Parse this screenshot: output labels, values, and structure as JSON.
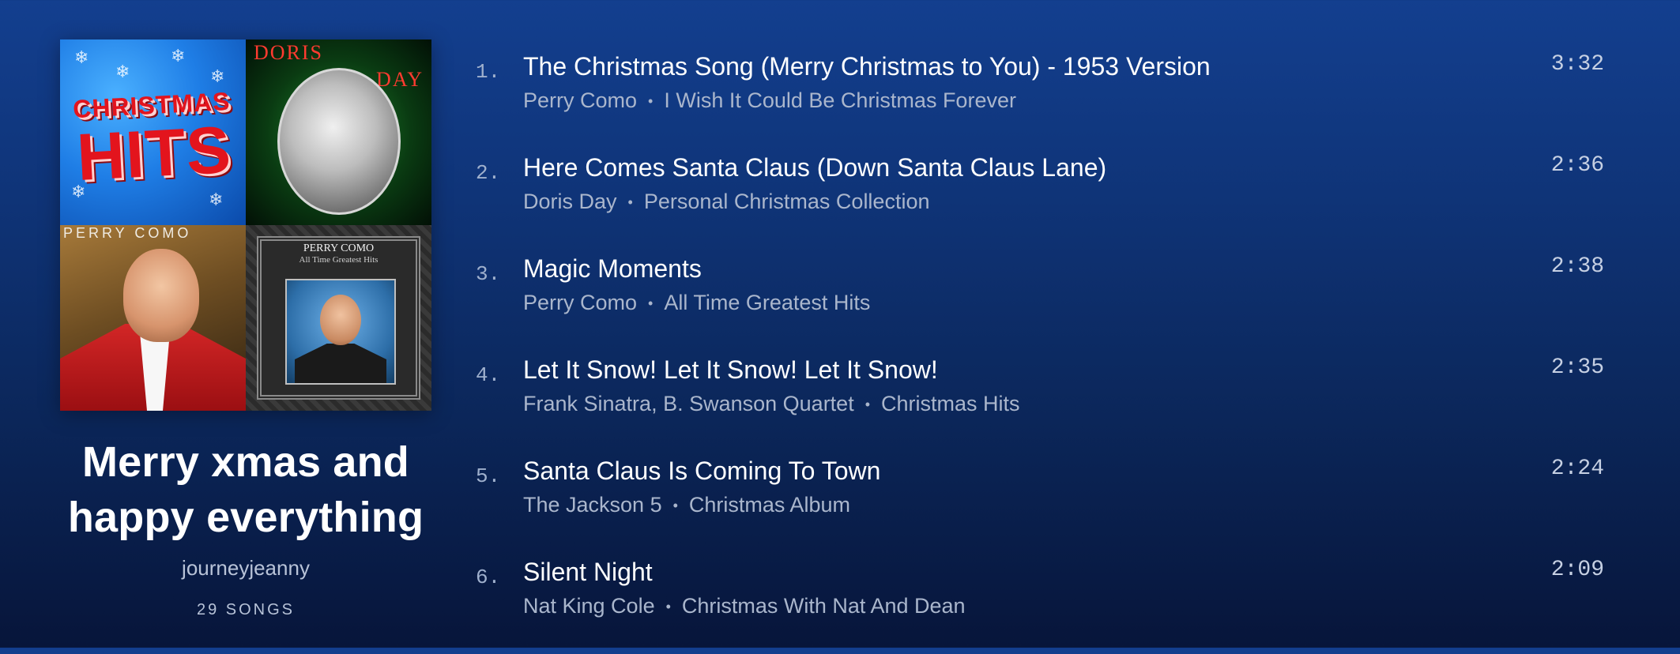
{
  "playlist": {
    "title_line1": "Merry xmas and",
    "title_line2": "happy everything",
    "owner": "journeyjeanny",
    "song_count": "29 SONGS"
  },
  "cover_art": {
    "tile1": {
      "word1": "CHRISTMAS",
      "word2": "HITS"
    },
    "tile2": {
      "word1": "DORIS",
      "word2": "DAY"
    },
    "tile3": {
      "word1": "PERRY COMO"
    },
    "tile4": {
      "title": "PERRY COMO",
      "subtitle": "All Time Greatest Hits"
    }
  },
  "tracks": [
    {
      "number": "1.",
      "title": "The Christmas Song (Merry Christmas to You) - 1953 Version",
      "artist": "Perry Como",
      "album": "I Wish It Could Be Christmas Forever",
      "duration": "3:32"
    },
    {
      "number": "2.",
      "title": "Here Comes Santa Claus (Down Santa Claus Lane)",
      "artist": "Doris Day",
      "album": "Personal Christmas Collection",
      "duration": "2:36"
    },
    {
      "number": "3.",
      "title": "Magic Moments",
      "artist": "Perry Como",
      "album": "All Time Greatest Hits",
      "duration": "2:38"
    },
    {
      "number": "4.",
      "title": "Let It Snow! Let It Snow! Let It Snow!",
      "artist": "Frank Sinatra, B. Swanson Quartet",
      "album": "Christmas Hits",
      "duration": "2:35"
    },
    {
      "number": "5.",
      "title": "Santa Claus Is Coming To Town",
      "artist": "The Jackson 5",
      "album": "Christmas Album",
      "duration": "2:24"
    },
    {
      "number": "6.",
      "title": "Silent Night",
      "artist": "Nat King Cole",
      "album": "Christmas With Nat And Dean",
      "duration": "2:09"
    }
  ]
}
